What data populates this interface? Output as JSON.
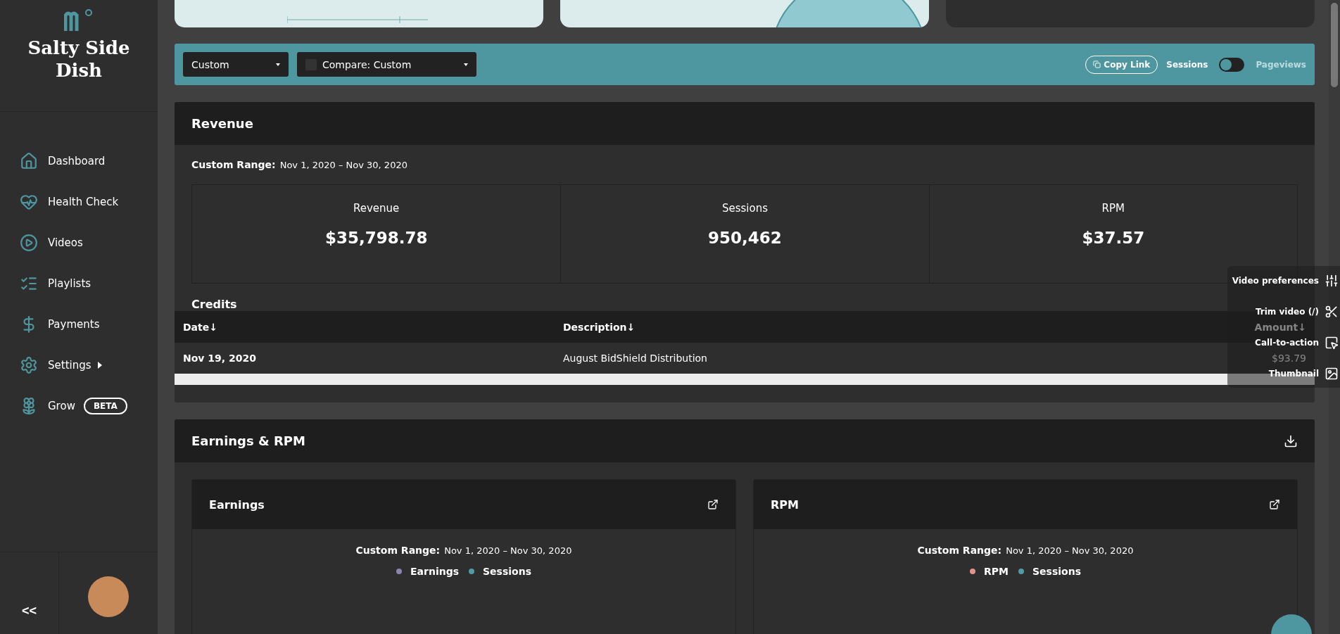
{
  "brand": {
    "name": "Salty Side Dish"
  },
  "nav": [
    {
      "label": "Dashboard",
      "selected": false
    },
    {
      "label": "Health Check",
      "selected": false
    },
    {
      "label": "Videos",
      "selected": false
    },
    {
      "label": "Playlists",
      "selected": false
    },
    {
      "label": "Payments",
      "selected": false
    },
    {
      "label": "Settings",
      "selected": false,
      "expandable": true
    },
    {
      "label": "Grow",
      "selected": false,
      "badge": "BETA"
    }
  ],
  "collapse": "<<",
  "filter_bar": {
    "range_select": "Custom",
    "compare": {
      "label": "Compare: Custom",
      "checked": false
    },
    "copy_link": "Copy Link",
    "toggle": {
      "left": "Sessions",
      "right": "Pageviews",
      "on": false
    }
  },
  "revenue": {
    "title": "Revenue",
    "range_label": "Custom Range:",
    "range": "Nov 1, 2020 – Nov 30, 2020",
    "stats": [
      {
        "label": "Revenue",
        "value": "$35,798.78"
      },
      {
        "label": "Sessions",
        "value": "950,462"
      },
      {
        "label": "RPM",
        "value": "$37.57"
      }
    ],
    "credits": {
      "title": "Credits",
      "columns": [
        "Date↓",
        "Description↓",
        "Amount↓"
      ],
      "rows": [
        [
          "Nov 19, 2020",
          "August BidShield Distribution",
          "$93.79"
        ]
      ]
    }
  },
  "video_menu": [
    {
      "label": "Video preferences"
    },
    {
      "label": "Trim video (/)"
    },
    {
      "label": "Call-to-action"
    },
    {
      "label": "Thumbnail"
    }
  ],
  "earnings": {
    "title": "Earnings & RPM",
    "charts": [
      {
        "title": "Earnings",
        "range_label": "Custom Range:",
        "range": "Nov 1, 2020 – Nov 30, 2020",
        "legend": [
          {
            "label": "Earnings",
            "color": "#8a84b0"
          },
          {
            "label": "Sessions",
            "color": "#4f9ca6"
          }
        ]
      },
      {
        "title": "RPM",
        "range_label": "Custom Range:",
        "range": "Nov 1, 2020 – Nov 30, 2020",
        "legend": [
          {
            "label": "RPM",
            "color": "#e0958a"
          },
          {
            "label": "Sessions",
            "color": "#4f9ca6"
          }
        ]
      }
    ]
  }
}
